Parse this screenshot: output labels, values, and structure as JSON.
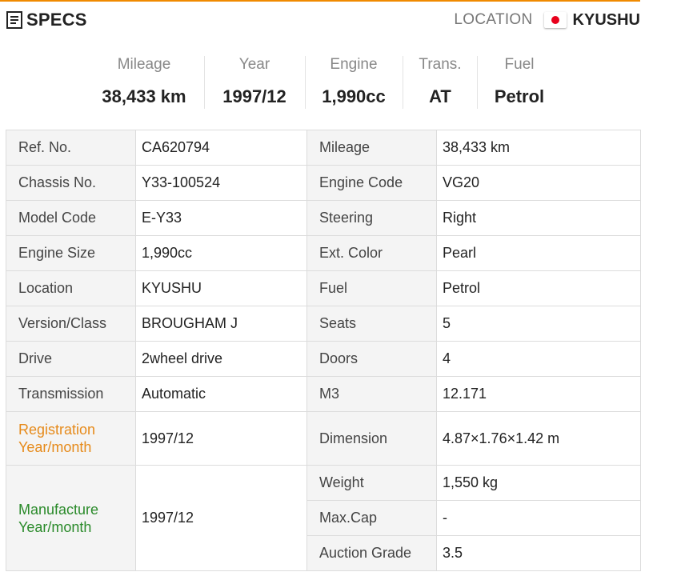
{
  "header": {
    "title": "SPECS",
    "location_label": "LOCATION",
    "location_value": "KYUSHU",
    "flag_icon": "japan-flag-icon",
    "accent_color": "#f08a00"
  },
  "summary": [
    {
      "label": "Mileage",
      "value": "38,433 km"
    },
    {
      "label": "Year",
      "value": "1997/12"
    },
    {
      "label": "Engine",
      "value": "1,990cc"
    },
    {
      "label": "Trans.",
      "value": "AT"
    },
    {
      "label": "Fuel",
      "value": "Petrol"
    }
  ],
  "specs": {
    "ref_no": {
      "label": "Ref. No.",
      "value": "CA620794"
    },
    "chassis_no": {
      "label": "Chassis No.",
      "value": "Y33-100524"
    },
    "model_code": {
      "label": "Model Code",
      "value": "E-Y33"
    },
    "engine_size": {
      "label": "Engine Size",
      "value": "1,990cc"
    },
    "location": {
      "label": "Location",
      "value": "KYUSHU"
    },
    "version_class": {
      "label": "Version/Class",
      "value": "BROUGHAM J"
    },
    "drive": {
      "label": "Drive",
      "value": "2wheel drive"
    },
    "transmission": {
      "label": "Transmission",
      "value": "Automatic"
    },
    "registration": {
      "label_line1": "Registration",
      "label_line2": "Year/month",
      "value": "1997/12",
      "color": "#e68a1a"
    },
    "manufacture": {
      "label_line1": "Manufacture",
      "label_line2": "Year/month",
      "value": "1997/12",
      "color": "#2a8a2a"
    },
    "mileage": {
      "label": "Mileage",
      "value": "38,433 km"
    },
    "engine_code": {
      "label": "Engine Code",
      "value": "VG20"
    },
    "steering": {
      "label": "Steering",
      "value": "Right"
    },
    "ext_color": {
      "label": "Ext. Color",
      "value": "Pearl"
    },
    "fuel": {
      "label": "Fuel",
      "value": "Petrol"
    },
    "seats": {
      "label": "Seats",
      "value": "5"
    },
    "doors": {
      "label": "Doors",
      "value": "4"
    },
    "m3": {
      "label": "M3",
      "value": "12.171"
    },
    "dimension": {
      "label": "Dimension",
      "value": "4.87×1.76×1.42 m"
    },
    "weight": {
      "label": "Weight",
      "value": "1,550 kg"
    },
    "max_cap": {
      "label": "Max.Cap",
      "value": "-"
    },
    "auction_grade": {
      "label": "Auction Grade",
      "value": "3.5"
    }
  }
}
